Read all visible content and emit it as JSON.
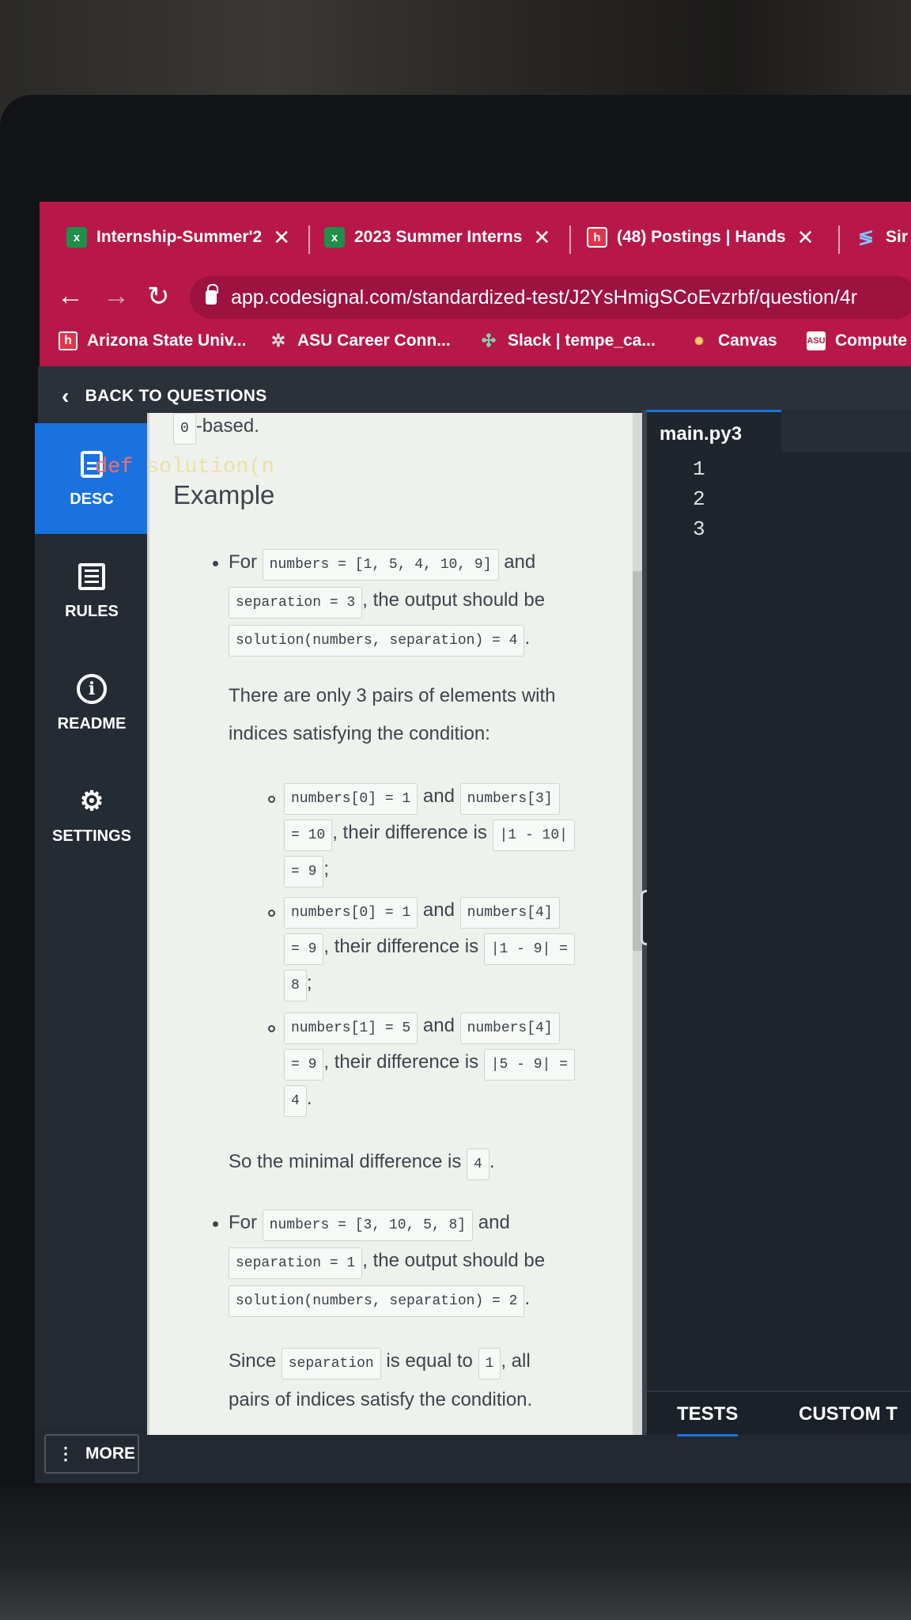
{
  "browser": {
    "tabs": [
      {
        "label": "Internship-Summer'2",
        "icon": "excel-icon",
        "close": "✕"
      },
      {
        "label": "2023 Summer Interns",
        "icon": "excel-icon",
        "close": "✕"
      },
      {
        "label": "(48) Postings | Hands",
        "icon": "handshake-icon",
        "close": "✕"
      },
      {
        "label": "Sir",
        "icon": "simplify-icon"
      }
    ],
    "url": "app.codesignal.com/standardized-test/J2YsHmigSCoEvzrbf/question/4r",
    "bookmarks": [
      {
        "label": "Arizona State Univ...",
        "icon": "handshake-icon"
      },
      {
        "label": "ASU Career Conn...",
        "icon": "gear-flower-icon"
      },
      {
        "label": "Slack | tempe_ca...",
        "icon": "slack-icon"
      },
      {
        "label": "Canvas",
        "icon": "canvas-icon"
      },
      {
        "label": "Compute",
        "icon": "asu-icon"
      }
    ]
  },
  "header": {
    "back_label": "BACK TO QUESTIONS"
  },
  "sidebar": {
    "items": [
      {
        "label": "DESC",
        "icon": "document-icon",
        "active": true
      },
      {
        "label": "RULES",
        "icon": "list-icon"
      },
      {
        "label": "README",
        "icon": "info-icon"
      },
      {
        "label": "SETTINGS",
        "icon": "gear-icon"
      }
    ],
    "more_label": "MORE"
  },
  "description": {
    "top_code": "0",
    "top_text": "-based.",
    "example_heading": "Example",
    "ex1": {
      "for": "For",
      "numbers_code": "numbers = [1, 5, 4, 10, 9]",
      "and": "and",
      "separation_code": "separation = 3",
      "output_text": ", the output should be",
      "solution_code": "solution(numbers, separation) = 4",
      "period": ".",
      "explain_line1": "There are only 3 pairs of elements with",
      "explain_line2": "indices satisfying the condition:",
      "pairs": [
        {
          "a": "numbers[0] = 1",
          "and": "and",
          "b": "numbers[3]",
          "b2": "= 10",
          "diff_text": ", their difference is",
          "diff": "|1 - 10|",
          "diff2": "= 9",
          "end": ";"
        },
        {
          "a": "numbers[0] = 1",
          "and": "and",
          "b": "numbers[4]",
          "b2": "= 9",
          "diff_text": ", their difference is",
          "diff": "|1 - 9| =",
          "diff2": "8",
          "end": ";"
        },
        {
          "a": "numbers[1] = 5",
          "and": "and",
          "b": "numbers[4]",
          "b2": "= 9",
          "diff_text": ", their difference is",
          "diff": "|5 - 9| =",
          "diff2": "4",
          "end": "."
        }
      ],
      "minimal_text": "So the minimal difference is",
      "minimal_code": "4",
      "minimal_end": "."
    },
    "ex2": {
      "for": "For",
      "numbers_code": "numbers = [3, 10, 5, 8]",
      "and": "and",
      "separation_code": "separation = 1",
      "output_text": ", the output should be",
      "solution_code": "solution(numbers, separation) = 2",
      "period": ".",
      "since": "Since",
      "since_code": "separation",
      "equal_text": "is equal to",
      "equal_code": "1",
      "all_text": ", all",
      "last_line": "pairs of indices satisfy the condition."
    }
  },
  "editor": {
    "file_tab": "main.py3",
    "line_numbers": [
      "1",
      "2",
      "3"
    ],
    "code_keyword": "def",
    "code_rest": "solution(n"
  },
  "bottom_tabs": {
    "tests": "TESTS",
    "custom": "CUSTOM T"
  },
  "colors": {
    "browser_accent": "#b8174a",
    "active_blue": "#1a72e0",
    "editor_bg": "#1e252d"
  }
}
